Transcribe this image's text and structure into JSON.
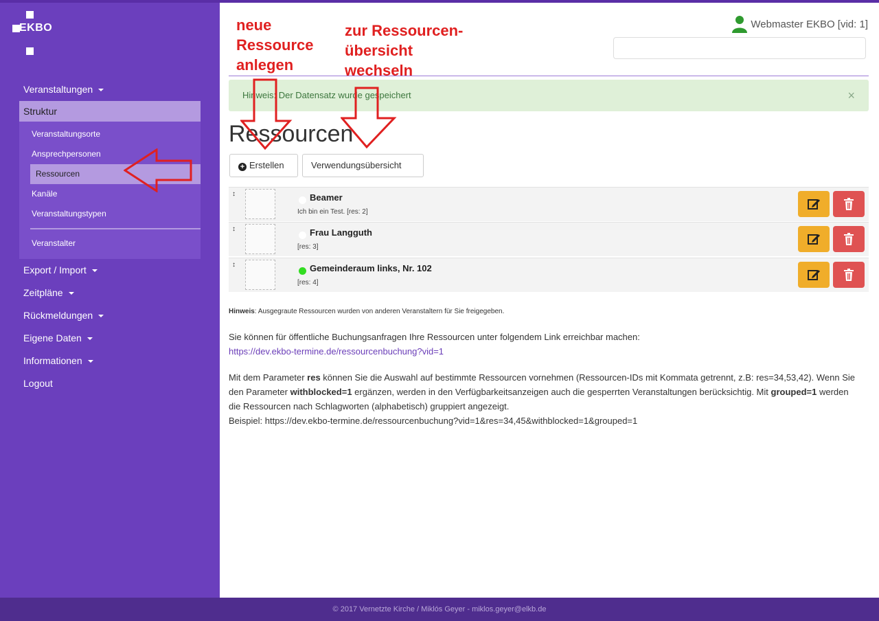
{
  "brand": {
    "name": "EKBO"
  },
  "sidebar": {
    "items": [
      {
        "label": "Veranstaltungen",
        "caret": true
      },
      {
        "label": "Struktur",
        "active": true
      },
      {
        "label": "Export / Import",
        "caret": true
      },
      {
        "label": "Zeitpläne",
        "caret": true
      },
      {
        "label": "Rückmeldungen",
        "caret": true
      },
      {
        "label": "Eigene Daten",
        "caret": true
      },
      {
        "label": "Informationen",
        "caret": true
      },
      {
        "label": "Logout"
      }
    ],
    "sub_items": [
      {
        "label": "Veranstaltungsorte"
      },
      {
        "label": "Ansprechpersonen"
      },
      {
        "label": "Ressourcen",
        "selected": true
      },
      {
        "label": "Kanäle"
      },
      {
        "label": "Veranstaltungstypen"
      },
      {
        "label": "Veranstalter"
      }
    ]
  },
  "header": {
    "user": "Webmaster EKBO [vid: 1]",
    "search_placeholder": ""
  },
  "annotations": {
    "left": "neue\nRessource\nanlegen",
    "right": "zur Ressourcen-\nübersicht\nwechseln"
  },
  "alert": {
    "text": "Hinweis: Der Datensatz wurde gespeichert",
    "close": "×"
  },
  "page": {
    "title": "Ressourcen",
    "create_label": "Erstellen",
    "overview_label": "Verwendungsübersicht"
  },
  "resources": [
    {
      "name": "Beamer",
      "sub": "Ich bin ein Test. [res: 2]",
      "status": "white"
    },
    {
      "name": "Frau Langguth",
      "sub": "[res: 3]",
      "status": "white"
    },
    {
      "name": "Gemeinderaum links, Nr. 102",
      "sub": "[res: 4]",
      "status": "green"
    }
  ],
  "info": {
    "hint_bold": "Hinweis",
    "hint_text": ": Ausgegraute Ressourcen wurden von anderen Veranstaltern für Sie freigegeben.",
    "public_text": "Sie können für öffentliche Buchungsanfragen Ihre Ressourcen unter folgendem Link erreichbar machen:",
    "public_link": "https://dev.ekbo-termine.de/ressourcenbuchung?vid=1",
    "param_1": "Mit dem Parameter ",
    "param_res": "res",
    "param_2": " können Sie die Auswahl auf bestimmte Ressourcen vornehmen (Ressourcen-IDs mit Kommata getrennt, z.B: res=34,53,42). Wenn Sie den Parameter ",
    "param_withblocked": "withblocked=1",
    "param_3": " ergänzen, werden in den Verfügbarkeitsanzeigen auch die gesperrten Veranstaltungen berücksichtig. Mit ",
    "param_grouped": "grouped=1",
    "param_4": " werden die Ressourcen nach Schlagworten (alphabetisch) gruppiert angezeigt.",
    "example": "Beispiel: https://dev.ekbo-termine.de/ressourcenbuchung?vid=1&res=34,45&withblocked=1&grouped=1"
  },
  "footer": {
    "text": "© 2017 Vernetzte Kirche / Miklós Geyer - miklos.geyer@elkb.de"
  },
  "colors": {
    "sidebar": "#6b3fbd",
    "accent": "#b49ae0",
    "edit": "#f0ad2a",
    "delete": "#df5252",
    "annotation": "#e02020"
  }
}
